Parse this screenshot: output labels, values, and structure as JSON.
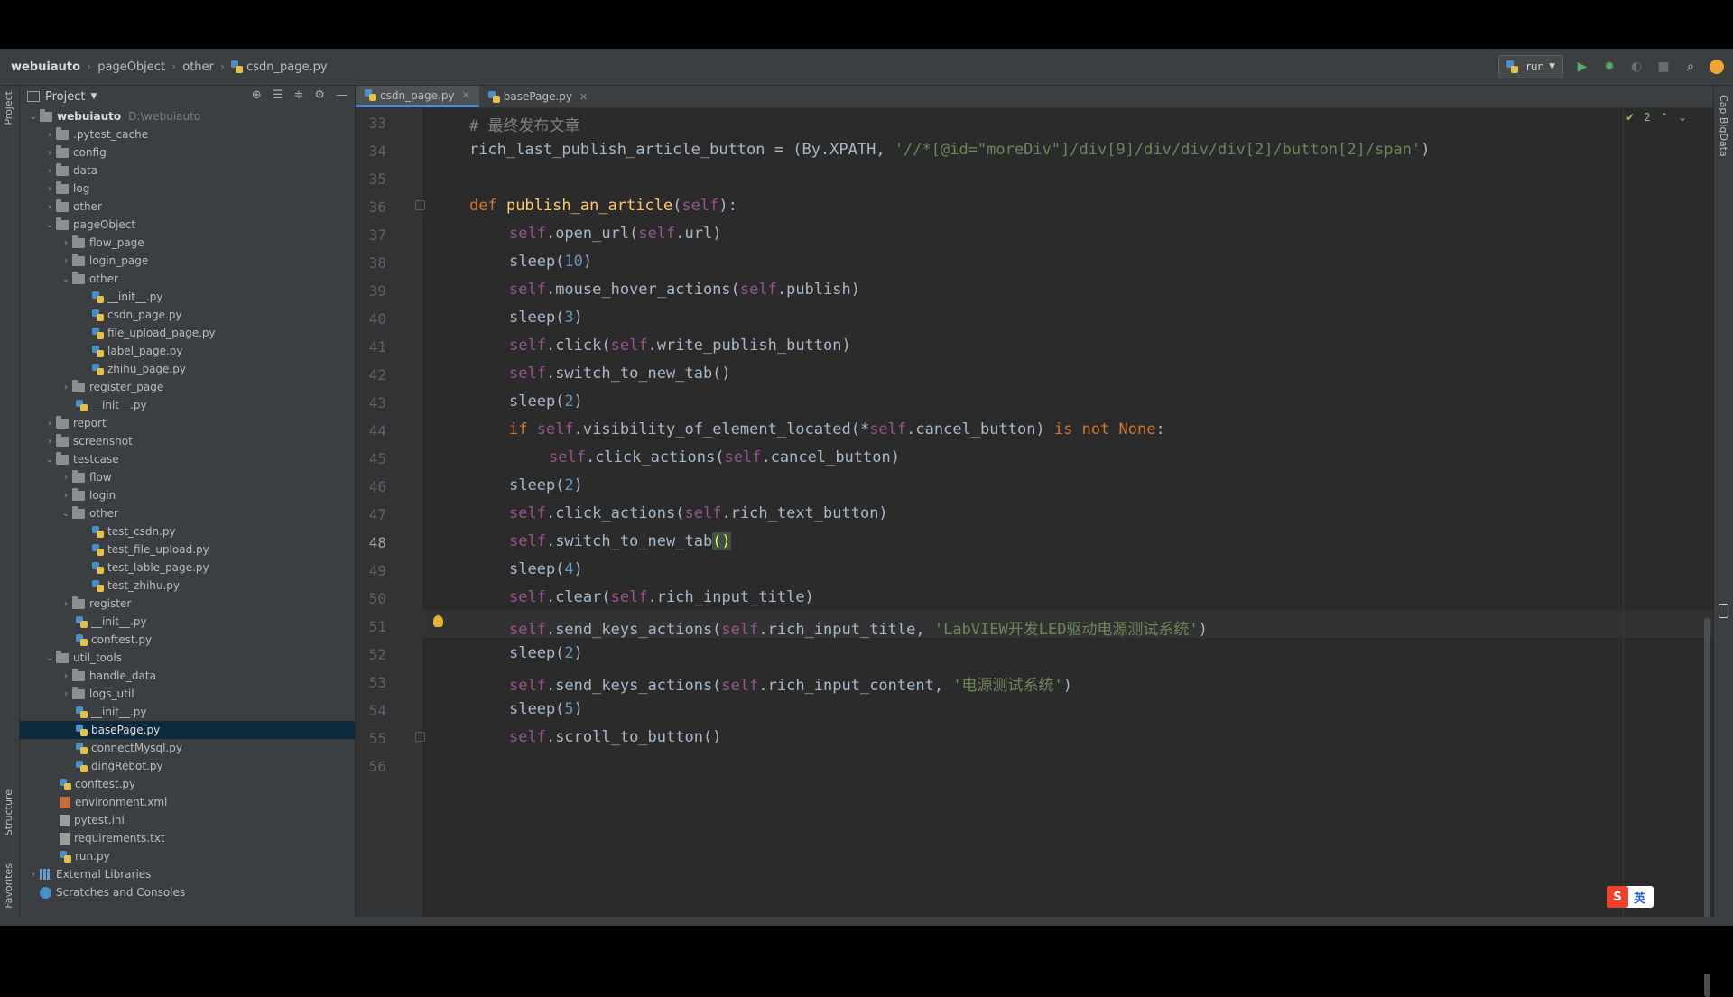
{
  "breadcrumb": [
    "webuiauto",
    "pageObject",
    "other",
    "csdn_page.py"
  ],
  "toolbar": {
    "run_config": "run"
  },
  "colors": {
    "accent": "#4a88c7",
    "selection": "#0d293e",
    "editor_bg": "#2b2b2b"
  },
  "side_tools": {
    "project": "Project",
    "structure": "Structure",
    "favorites": "Favorites",
    "right": "Cap BigData"
  },
  "project_panel": {
    "title": "Project",
    "items": [
      {
        "label": "webuiauto",
        "hint": "D:\\webuiauto"
      },
      {
        "label": ".pytest_cache"
      },
      {
        "label": "config"
      },
      {
        "label": "data"
      },
      {
        "label": "log"
      },
      {
        "label": "other"
      },
      {
        "label": "pageObject"
      },
      {
        "label": "flow_page"
      },
      {
        "label": "login_page"
      },
      {
        "label": "other"
      },
      {
        "label": "__init__.py"
      },
      {
        "label": "csdn_page.py"
      },
      {
        "label": "file_upload_page.py"
      },
      {
        "label": "label_page.py"
      },
      {
        "label": "zhihu_page.py"
      },
      {
        "label": "register_page"
      },
      {
        "label": "__init__.py"
      },
      {
        "label": "report"
      },
      {
        "label": "screenshot"
      },
      {
        "label": "testcase"
      },
      {
        "label": "flow"
      },
      {
        "label": "login"
      },
      {
        "label": "other"
      },
      {
        "label": "test_csdn.py"
      },
      {
        "label": "test_file_upload.py"
      },
      {
        "label": "test_lable_page.py"
      },
      {
        "label": "test_zhihu.py"
      },
      {
        "label": "register"
      },
      {
        "label": "__init__.py"
      },
      {
        "label": "conftest.py"
      },
      {
        "label": "util_tools"
      },
      {
        "label": "handle_data"
      },
      {
        "label": "logs_util"
      },
      {
        "label": "__init__.py"
      },
      {
        "label": "basePage.py"
      },
      {
        "label": "connectMysql.py"
      },
      {
        "label": "dingRebot.py"
      },
      {
        "label": "conftest.py"
      },
      {
        "label": "environment.xml"
      },
      {
        "label": "pytest.ini"
      },
      {
        "label": "requirements.txt"
      },
      {
        "label": "run.py"
      },
      {
        "label": "External Libraries"
      },
      {
        "label": "Scratches and Consoles"
      }
    ]
  },
  "editor": {
    "tabs": [
      {
        "label": "csdn_page.py"
      },
      {
        "label": "basePage.py"
      }
    ],
    "inspection_count": "2",
    "line_numbers": [
      "33",
      "34",
      "35",
      "36",
      "37",
      "38",
      "39",
      "40",
      "41",
      "42",
      "43",
      "44",
      "45",
      "46",
      "47",
      "48",
      "49",
      "50",
      "51",
      "52",
      "53",
      "54",
      "55",
      "56"
    ],
    "current_line": "48",
    "code": {
      "l33_comment": "# 最终发布文章",
      "l34_a": "rich_last_publish_article_button = (By.XPATH, ",
      "l34_str": "'//*[@id=\"moreDiv\"]/div[9]/div/div/div[2]/button[2]/span'",
      "l34_b": ")",
      "l36_def": "def ",
      "l36_name": "publish_an_article",
      "l36_self": "self",
      "self": "self",
      "l37": ".open_url(",
      "l37_b": ".url)",
      "sleep": "sleep(",
      "n10": "10",
      "n3": "3",
      "n2": "2",
      "n4": "4",
      "n5": "5",
      "close": ")",
      "l39": ".mouse_hover_actions(",
      "l39_b": ".publish)",
      "l41": ".click(",
      "l41_b": ".write_publish_button)",
      "l42": ".switch_to_new_tab()",
      "l44_if": "if ",
      "l44_a": ".visibility_of_element_located(*",
      "l44_b": ".cancel_button) ",
      "l44_isnot": "is not None",
      "l44_colon": ":",
      "l45": ".click_actions(",
      "l45_b": ".cancel_button)",
      "l47": ".click_actions(",
      "l47_b": ".rich_text_button)",
      "l48": ".switch_to_new_tab",
      "l48_parens": "()",
      "l50": ".clear(",
      "l50_b": ".rich_input_title)",
      "l51": ".send_keys_actions(",
      "l51_b": ".rich_input_title, ",
      "l51_str": "'LabVIEW开发LED驱动电源测试系统'",
      "l53": ".send_keys_actions(",
      "l53_b": ".rich_input_content, ",
      "l53_str": "'电源测试系统'",
      "l55": ".scroll_to_button()"
    }
  },
  "ime_badge": {
    "s": "S",
    "lang": "英"
  }
}
